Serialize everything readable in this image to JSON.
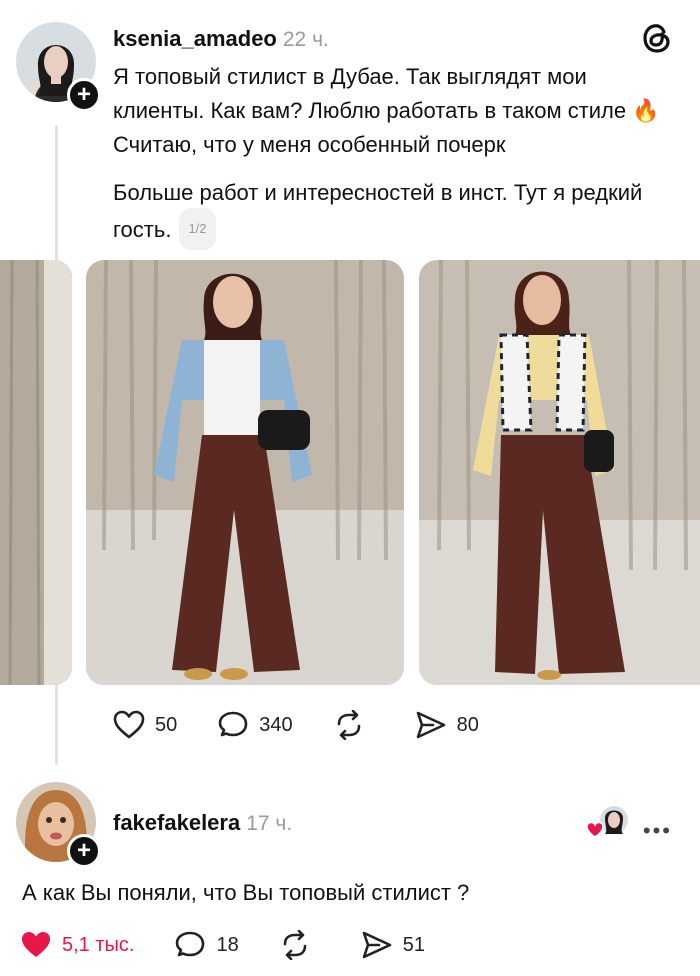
{
  "post": {
    "username": "ksenia_amadeo",
    "time": "22 ч.",
    "paragraph1": "Я топовый стилист в Дубае. Так выглядят мои клиенты. Как вам? Люблю работать в таком стиле 🔥 Считаю, что у меня особенный почерк",
    "paragraph2": "Больше работ и интересностей в инст. Тут я редкий гость.",
    "page_indicator": "1/2",
    "likes": "50",
    "comments": "340",
    "shares": "80"
  },
  "reply": {
    "username": "fakefakelera",
    "time": "17 ч.",
    "text": "А как Вы поняли, что Вы топовый стилист ?",
    "likes": "5,1 тыс.",
    "comments": "18",
    "shares": "51"
  },
  "icons": {
    "brand": "threads-logo",
    "like": "heart-icon",
    "comment": "speech-bubble-icon",
    "repost": "repost-icon",
    "share": "send-icon",
    "more": "more-icon"
  },
  "colors": {
    "like_active": "#e8174a",
    "text_secondary": "#9a9a9a",
    "accent": "#111111"
  }
}
